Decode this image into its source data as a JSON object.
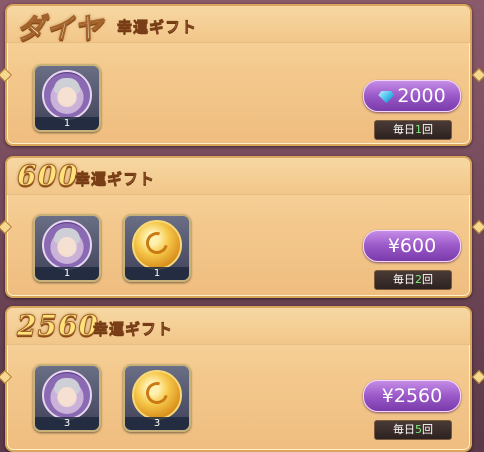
{
  "packs": [
    {
      "title_big": "ダイヤ",
      "title_small": "幸運ギフト",
      "items": [
        {
          "icon": "character-portrait-icon",
          "qty": "1"
        }
      ],
      "price": "2000",
      "price_icon": "diamond-gem-icon",
      "limit": {
        "prefix": "毎日",
        "count": "1",
        "suffix": "回"
      }
    },
    {
      "title_big": "600",
      "title_small": "幸運ギフト",
      "items": [
        {
          "icon": "character-portrait-icon",
          "qty": "1"
        },
        {
          "icon": "gold-coin-icon",
          "qty": "1"
        }
      ],
      "price": "¥600",
      "limit": {
        "prefix": "毎日",
        "count": "2",
        "suffix": "回"
      }
    },
    {
      "title_big": "2560",
      "title_small": "幸運ギフト",
      "items": [
        {
          "icon": "character-portrait-icon",
          "qty": "3"
        },
        {
          "icon": "gold-coin-icon",
          "qty": "3"
        }
      ],
      "price": "¥2560",
      "limit": {
        "prefix": "毎日",
        "count": "5",
        "suffix": "回"
      }
    }
  ],
  "colors": {
    "card_bg": "#f4c98e",
    "card_border": "#d9a55a",
    "price_button": "#9a58c8",
    "limit_count": "#7cf07a"
  }
}
